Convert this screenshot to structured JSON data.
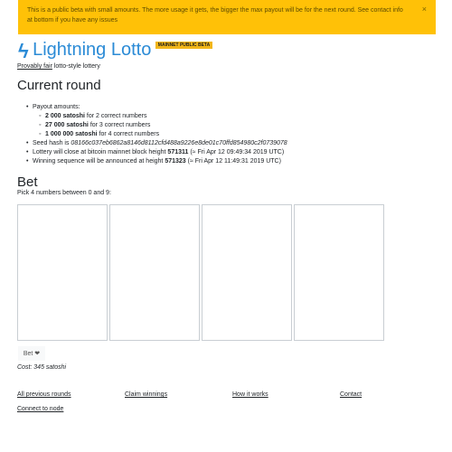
{
  "alert": {
    "text": "This is a public beta with small amounts. The more usage it gets, the bigger the max payout will be for the next round. See contact info at bottom if you have any issues",
    "close_glyph": "×",
    "background_color": "#ffc107"
  },
  "header": {
    "icon": "lightning-bolt-icon",
    "icon_glyph": "ϟ",
    "title": "Lightning Lotto",
    "badge": "MAINNET PUBLIC BETA",
    "subtitle_link": "Provably fair",
    "subtitle_rest": " lotto-style lottery",
    "title_color": "#2b8bd6"
  },
  "current_round": {
    "heading": "Current round",
    "payout_label": "Payout amounts:",
    "payouts": [
      {
        "amount": "2 000 satoshi",
        "desc": " for 2 correct numbers"
      },
      {
        "amount": "27 000 satoshi",
        "desc": " for 3 correct numbers"
      },
      {
        "amount": "1 000 000 satoshi",
        "desc": " for 4 correct numbers"
      }
    ],
    "seed_prefix": "Seed hash is ",
    "seed_hash": "08166c037eb6862a8146d8112cfd488a9226e8de01c70ffd854980c2f0739078",
    "close_prefix": "Lottery will close at bitcoin mainnet block height ",
    "close_height": "571311",
    "close_suffix": " (≈ Fri Apr 12 09:49:34 2019 UTC)",
    "announce_prefix": "Winning sequence will be announced at height ",
    "announce_height": "571323",
    "announce_suffix": " (≈ Fri Apr 12 11:49:31 2019 UTC)"
  },
  "bet": {
    "heading": "Bet",
    "instruction": "Pick 4 numbers between 0 and 9:",
    "button_label": "Bet",
    "button_icon": "heart-icon",
    "button_icon_glyph": "❤",
    "cost": "Cost: 345 satoshi"
  },
  "footer": {
    "links": [
      "All previous rounds",
      "Claim winnings",
      "How it works",
      "Contact"
    ],
    "connect": "Connect to node"
  }
}
